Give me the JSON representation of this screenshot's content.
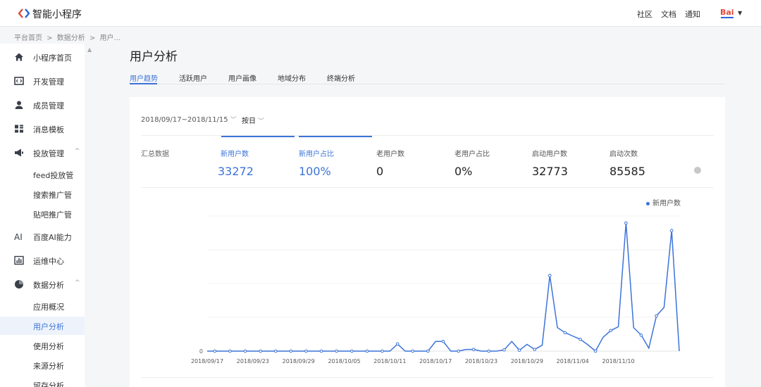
{
  "header": {
    "brand": "智能小程序",
    "links": [
      "社区",
      "文档",
      "通知"
    ],
    "logo_icon": "baidu-smart-program-logo",
    "avatar_icon": "baidu-avatar"
  },
  "breadcrumb": [
    "平台首页",
    ">",
    "数据分析",
    ">",
    "用户..."
  ],
  "sidebar": {
    "items": [
      {
        "label": "小程序首页",
        "icon": "home-icon"
      },
      {
        "label": "开发管理",
        "icon": "code-icon"
      },
      {
        "label": "成员管理",
        "icon": "user-icon"
      },
      {
        "label": "消息模板",
        "icon": "template-icon"
      },
      {
        "label": "投放管理",
        "icon": "megaphone-icon",
        "chevron": "^"
      },
      {
        "label": "百度AI能力",
        "icon": "ai-icon"
      },
      {
        "label": "运维中心",
        "icon": "chart-bars-icon"
      },
      {
        "label": "数据分析",
        "icon": "pie-chart-icon",
        "chevron": "^"
      }
    ],
    "launch_sub": [
      "feed投放管",
      "搜索推广管",
      "贴吧推广管"
    ],
    "data_sub": [
      "应用概况",
      "用户分析",
      "使用分析",
      "来源分析",
      "留存分析"
    ],
    "active_sub": "用户分析"
  },
  "main": {
    "title": "用户分析",
    "tabs": [
      "用户趋势",
      "活跃用户",
      "用户画像",
      "地域分布",
      "终端分析"
    ],
    "active_tab": "用户趋势",
    "date_range": "2018/09/17~2018/11/15",
    "granularity": "按日",
    "summary_label": "汇总数据",
    "metrics": [
      {
        "label": "新用户数",
        "value": "33272",
        "selected": true
      },
      {
        "label": "新用户占比",
        "value": "100%",
        "selected": true
      },
      {
        "label": "老用户数",
        "value": "0",
        "selected": false
      },
      {
        "label": "老用户占比",
        "value": "0%",
        "selected": false
      },
      {
        "label": "启动用户数",
        "value": "32773",
        "selected": false
      },
      {
        "label": "启动次数",
        "value": "85585",
        "selected": false
      }
    ],
    "accent_color": "#3c73d9"
  },
  "chart_data": {
    "type": "line",
    "legend": "新用户数",
    "legend_position": "top-right",
    "x_ticks": [
      "2018/09/17",
      "2018/09/23",
      "2018/09/29",
      "2018/10/05",
      "2018/10/11",
      "2018/10/17",
      "2018/10/23",
      "2018/10/29",
      "2018/11/04",
      "2018/11/10"
    ],
    "y_ticks": [
      "0"
    ],
    "grid": true,
    "ylim": [
      0,
      3200
    ],
    "series": [
      {
        "name": "新用户数",
        "values": [
          0,
          0,
          0,
          0,
          0,
          0,
          0,
          0,
          0,
          0,
          0,
          0,
          0,
          0,
          0,
          0,
          0,
          0,
          0,
          0,
          0,
          0,
          0,
          0,
          0,
          170,
          0,
          0,
          0,
          0,
          230,
          230,
          0,
          0,
          40,
          40,
          0,
          0,
          0,
          30,
          230,
          20,
          160,
          40,
          140,
          1800,
          560,
          440,
          360,
          280,
          150,
          0,
          330,
          490,
          580,
          3050,
          560,
          380,
          70,
          840,
          1040,
          2870,
          0
        ]
      }
    ]
  }
}
